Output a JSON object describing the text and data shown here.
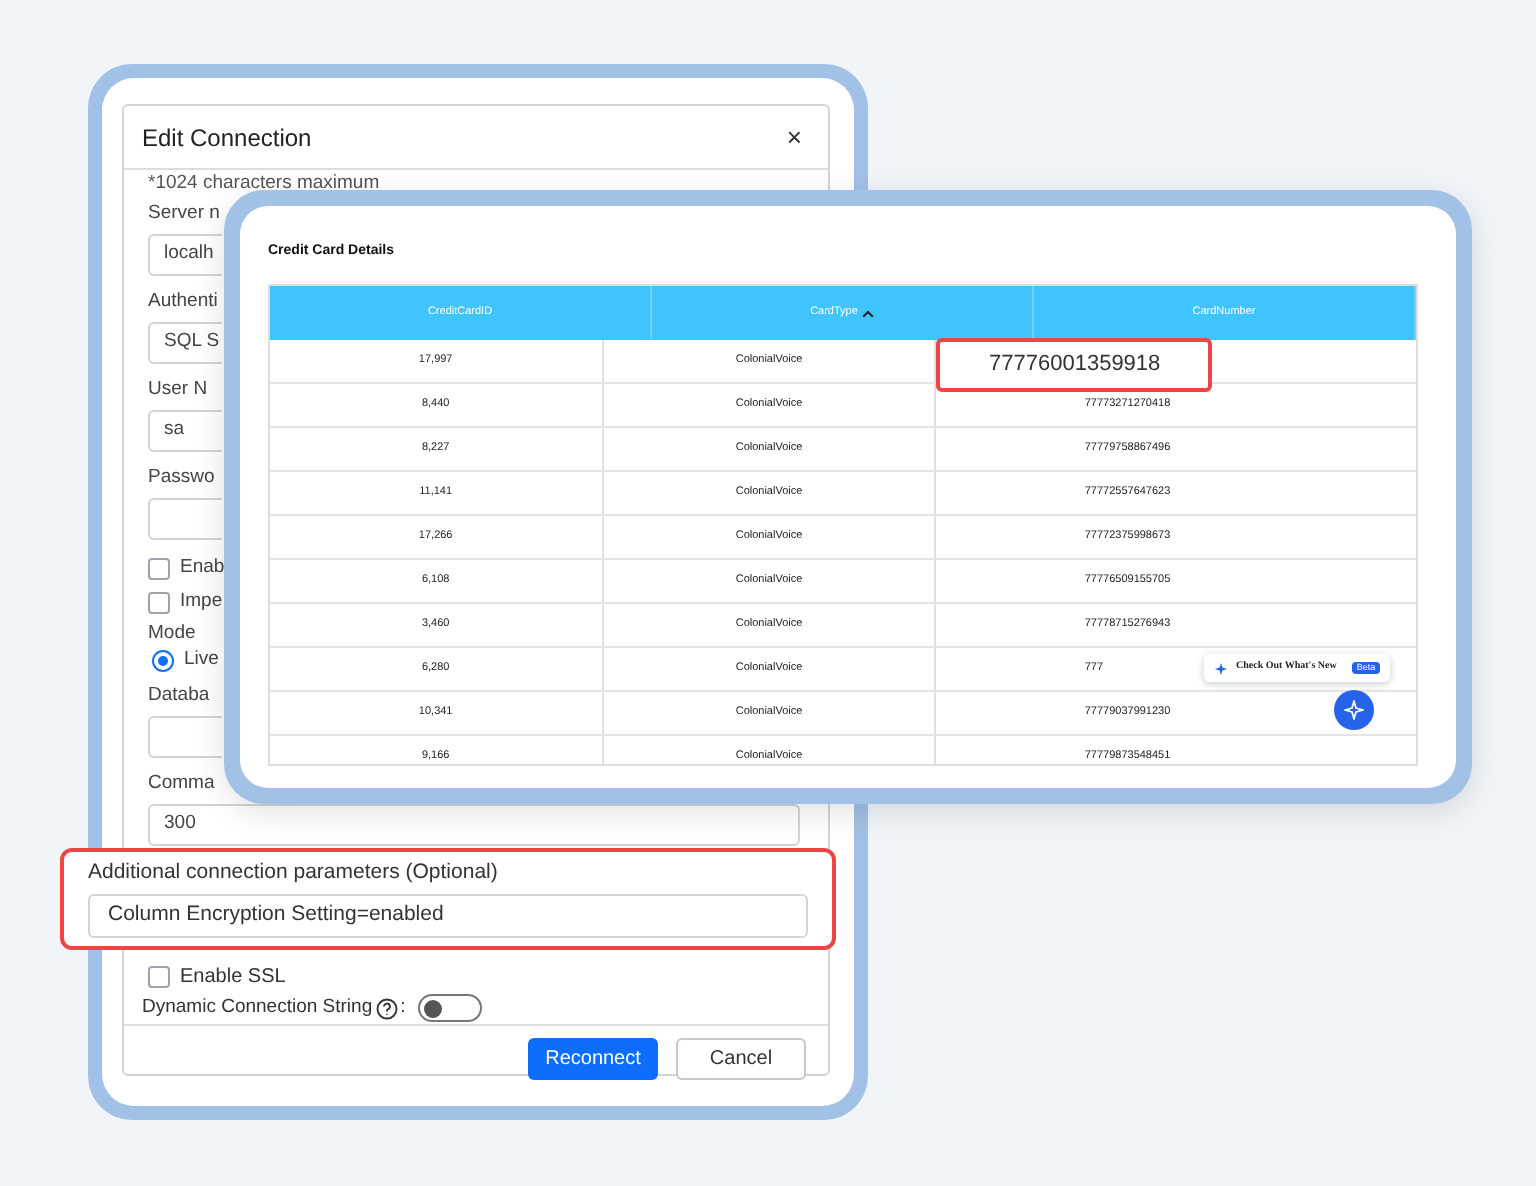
{
  "edit_dialog": {
    "title": "Edit Connection",
    "close": "×",
    "note": "*1024 characters maximum",
    "form": [
      {
        "kind": "field",
        "label": "Server n",
        "value": "localh"
      },
      {
        "kind": "field",
        "label": "Authenti",
        "value": "SQL S"
      },
      {
        "kind": "field",
        "label": "User N",
        "value": "sa"
      },
      {
        "kind": "field",
        "label": "Passwo"
      },
      {
        "kind": "checkbox",
        "label": "Enab",
        "checked": false
      },
      {
        "kind": "checkbox",
        "label": "Impe",
        "checked": false
      },
      {
        "kind": "radio",
        "label": "Mode",
        "options": [
          {
            "label": "Live",
            "selected": true
          }
        ]
      },
      {
        "kind": "field",
        "label": "Databa"
      },
      {
        "kind": "full-field",
        "label": "Comma",
        "value": "300"
      }
    ],
    "highlighted_field": {
      "label": "Additional connection parameters (Optional)",
      "value": "Column Encryption Setting=enabled"
    },
    "options": [
      {
        "kind": "checkbox",
        "label": "Enable SSL",
        "checked": false
      },
      {
        "kind": "toggle",
        "label": "Dynamic Connection String",
        "suffix": ":",
        "on": false
      }
    ],
    "buttons": [
      {
        "label": "Reconnect",
        "kind": "primary"
      },
      {
        "label": "Cancel",
        "kind": "secondary"
      }
    ]
  },
  "grid_window": {
    "title": "Credit Card Details",
    "columns": [
      {
        "label": "CreditCardID",
        "sorted": false
      },
      {
        "label": "CardType",
        "sorted": true
      },
      {
        "label": "CardNumber",
        "sorted": false
      }
    ],
    "rows": [
      {
        "id": "17,997",
        "type": "ColonialVoice",
        "highlighted": true,
        "number": "77776001359918"
      },
      {
        "id": "8,440",
        "type": "ColonialVoice",
        "highlighted": false,
        "number": "77773271270418"
      },
      {
        "id": "8,227",
        "type": "ColonialVoice",
        "highlighted": false,
        "number": "77779758867496"
      },
      {
        "id": "11,141",
        "type": "ColonialVoice",
        "highlighted": false,
        "number": "77772557647623"
      },
      {
        "id": "17,266",
        "type": "ColonialVoice",
        "highlighted": false,
        "number": "77772375998673"
      },
      {
        "id": "6,108",
        "type": "ColonialVoice",
        "highlighted": false,
        "number": "77776509155705"
      },
      {
        "id": "3,460",
        "type": "ColonialVoice",
        "highlighted": false,
        "number": "77778715276943"
      },
      {
        "id": "6,280",
        "type": "ColonialVoice",
        "highlighted": false,
        "number": "777"
      },
      {
        "id": "10,341",
        "type": "ColonialVoice",
        "highlighted": false,
        "number": "77779037991230"
      },
      {
        "id": "9,166",
        "type": "ColonialVoice",
        "highlighted": false,
        "number": "77779873548451"
      }
    ],
    "whats_new": {
      "label": "Check Out What's New",
      "badge": "Beta"
    }
  }
}
